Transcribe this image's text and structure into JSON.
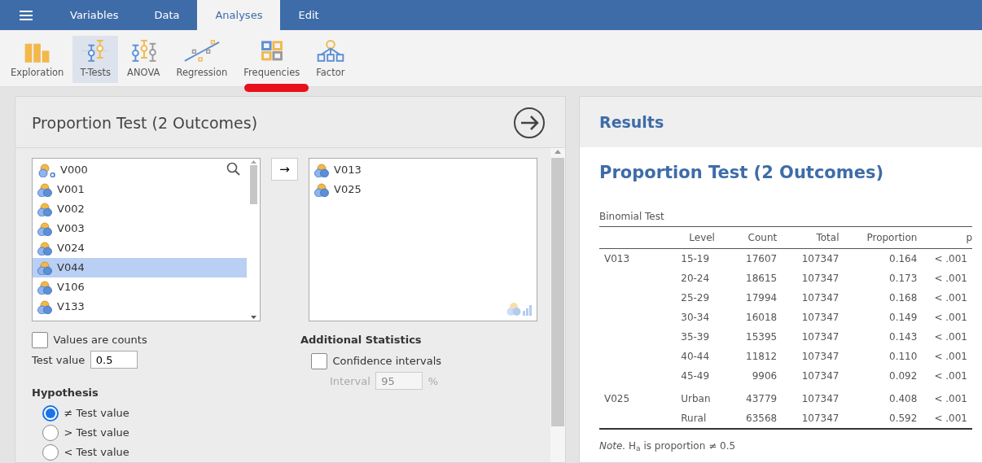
{
  "menu_tabs": [
    {
      "label": "Variables",
      "selected": false
    },
    {
      "label": "Data",
      "selected": false
    },
    {
      "label": "Analyses",
      "selected": true
    },
    {
      "label": "Edit",
      "selected": false
    }
  ],
  "toolbar": [
    {
      "label": "Exploration",
      "kind": "exploration",
      "selected": false,
      "highlighted": false
    },
    {
      "label": "T-Tests",
      "kind": "ttests",
      "selected": true,
      "highlighted": false
    },
    {
      "label": "ANOVA",
      "kind": "anova",
      "selected": false,
      "highlighted": false
    },
    {
      "label": "Regression",
      "kind": "regression",
      "selected": false,
      "highlighted": false
    },
    {
      "label": "Frequencies",
      "kind": "frequencies",
      "selected": false,
      "highlighted": true
    },
    {
      "label": "Factor",
      "kind": "factor",
      "selected": false,
      "highlighted": false
    }
  ],
  "options_panel": {
    "title": "Proportion Test (2 Outcomes)",
    "variables": [
      {
        "name": "V000",
        "kind": "nominal-text",
        "selected": false
      },
      {
        "name": "V001",
        "kind": "nominal",
        "selected": false
      },
      {
        "name": "V002",
        "kind": "nominal",
        "selected": false
      },
      {
        "name": "V003",
        "kind": "nominal",
        "selected": false
      },
      {
        "name": "V024",
        "kind": "nominal",
        "selected": false
      },
      {
        "name": "V044",
        "kind": "nominal",
        "selected": true
      },
      {
        "name": "V106",
        "kind": "nominal",
        "selected": false
      },
      {
        "name": "V133",
        "kind": "nominal",
        "selected": false
      }
    ],
    "arrow_button": "→",
    "target_variables": [
      {
        "name": "V013"
      },
      {
        "name": "V025"
      }
    ],
    "values_are_counts": {
      "label": "Values are counts",
      "checked": false
    },
    "test_value": {
      "label": "Test value",
      "value": "0.5"
    },
    "hypothesis": {
      "title": "Hypothesis",
      "options": [
        {
          "label": "≠ Test value",
          "selected": true
        },
        {
          "label": "> Test value",
          "selected": false
        },
        {
          "label": "< Test value",
          "selected": false
        }
      ]
    },
    "additional_statistics": {
      "title": "Additional Statistics",
      "confidence_intervals": {
        "label": "Confidence intervals",
        "checked": false
      },
      "interval": {
        "label": "Interval",
        "value": "95",
        "unit": "%",
        "disabled": true
      }
    }
  },
  "results": {
    "header": "Results",
    "title": "Proportion Test (2 Outcomes)",
    "table_title": "Binomial Test",
    "columns": [
      "Level",
      "Count",
      "Total",
      "Proportion",
      "p"
    ],
    "groups": [
      {
        "variable": "V013",
        "rows": [
          [
            "15-19",
            "17607",
            "107347",
            "0.164",
            "< .001"
          ],
          [
            "20-24",
            "18615",
            "107347",
            "0.173",
            "< .001"
          ],
          [
            "25-29",
            "17994",
            "107347",
            "0.168",
            "< .001"
          ],
          [
            "30-34",
            "16018",
            "107347",
            "0.149",
            "< .001"
          ],
          [
            "35-39",
            "15395",
            "107347",
            "0.143",
            "< .001"
          ],
          [
            "40-44",
            "11812",
            "107347",
            "0.110",
            "< .001"
          ],
          [
            "45-49",
            "9906",
            "107347",
            "0.092",
            "< .001"
          ]
        ]
      },
      {
        "variable": "V025",
        "rows": [
          [
            "Urban",
            "43779",
            "107347",
            "0.408",
            "< .001"
          ],
          [
            "Rural",
            "63568",
            "107347",
            "0.592",
            "< .001"
          ]
        ]
      }
    ],
    "note": "*Note.* H$_{a}$ is proportion ≠ 0.5"
  }
}
